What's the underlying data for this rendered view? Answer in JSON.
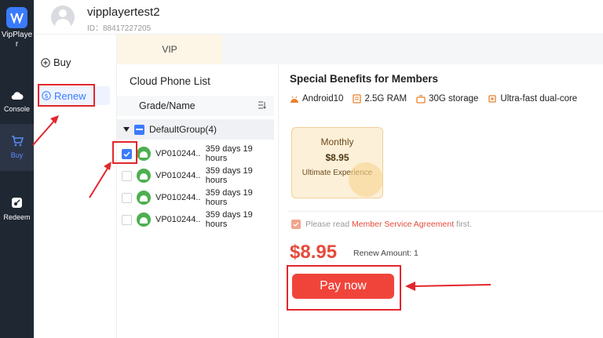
{
  "app": {
    "name": "VipPlayer"
  },
  "rail": [
    {
      "label": "Console",
      "icon": "cloud-icon"
    },
    {
      "label": "Buy",
      "icon": "cart-icon"
    },
    {
      "label": "Redeem",
      "icon": "redeem-icon"
    }
  ],
  "user": {
    "name": "vipplayertest2",
    "id": "ID：88417227205"
  },
  "sidebar": {
    "buy": "Buy",
    "renew": "Renew"
  },
  "tabs": {
    "vip": "VIP"
  },
  "list": {
    "title": "Cloud Phone List",
    "header": "Grade/Name",
    "group": "DefaultGroup(4)",
    "devices": [
      {
        "name": "VP010244...",
        "remaining": "359 days 19 hours",
        "checked": true
      },
      {
        "name": "VP010244...",
        "remaining": "359 days 19 hours",
        "checked": false
      },
      {
        "name": "VP010244...",
        "remaining": "359 days 19 hours",
        "checked": false
      },
      {
        "name": "VP010244...",
        "remaining": "359 days 19 hours",
        "checked": false
      }
    ]
  },
  "benefits": {
    "title": "Special Benefits for Members",
    "specs": [
      "Android10",
      "2.5G RAM",
      "30G storage",
      "Ultra-fast dual-core"
    ],
    "plan": {
      "name": "Monthly",
      "price": "$8.95",
      "desc": "Ultimate Experience"
    },
    "agree_prefix": "Please read ",
    "agree_link": "Member Service Agreement",
    "agree_suffix": " first.",
    "price": "$8.95",
    "amount": "Renew Amount: 1",
    "pay": "Pay now"
  },
  "colors": {
    "accent": "#3a7bfd",
    "danger": "#e54b3b",
    "rail": "#1f2733"
  }
}
